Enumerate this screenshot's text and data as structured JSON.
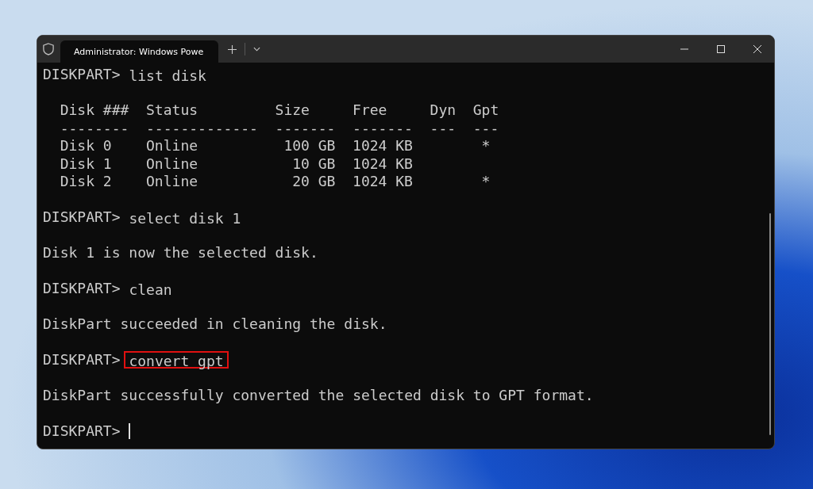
{
  "window": {
    "tab_title": "Administrator: Windows Powe",
    "tab_selected": true
  },
  "terminal": {
    "blocks": [
      {
        "kind": "command",
        "prompt": "DISKPART>",
        "command": "list disk",
        "highlighted": false
      },
      {
        "kind": "table",
        "columns": [
          {
            "label": "Disk ###",
            "rule": "--------"
          },
          {
            "label": "Status",
            "rule": "-------------"
          },
          {
            "label": "Size",
            "rule": "-------"
          },
          {
            "label": "Free",
            "rule": "-------"
          },
          {
            "label": "Dyn",
            "rule": "---"
          },
          {
            "label": "Gpt",
            "rule": "---"
          }
        ],
        "rows": [
          [
            "Disk 0",
            "Online",
            "100 GB",
            "1024 KB",
            null,
            "*"
          ],
          [
            "Disk 1",
            "Online",
            "10 GB",
            "1024 KB",
            null,
            null
          ],
          [
            "Disk 2",
            "Online",
            "20 GB",
            "1024 KB",
            null,
            "*"
          ]
        ]
      },
      {
        "kind": "command",
        "prompt": "DISKPART>",
        "command": "select disk 1",
        "highlighted": false
      },
      {
        "kind": "output",
        "text": "Disk 1 is now the selected disk."
      },
      {
        "kind": "command",
        "prompt": "DISKPART>",
        "command": "clean",
        "highlighted": false
      },
      {
        "kind": "output",
        "text": "DiskPart succeeded in cleaning the disk."
      },
      {
        "kind": "command",
        "prompt": "DISKPART>",
        "command": "convert gpt",
        "highlighted": true
      },
      {
        "kind": "output",
        "text": "DiskPart successfully converted the selected disk to GPT format."
      },
      {
        "kind": "input",
        "prompt": "DISKPART>",
        "cursor": true
      }
    ]
  }
}
